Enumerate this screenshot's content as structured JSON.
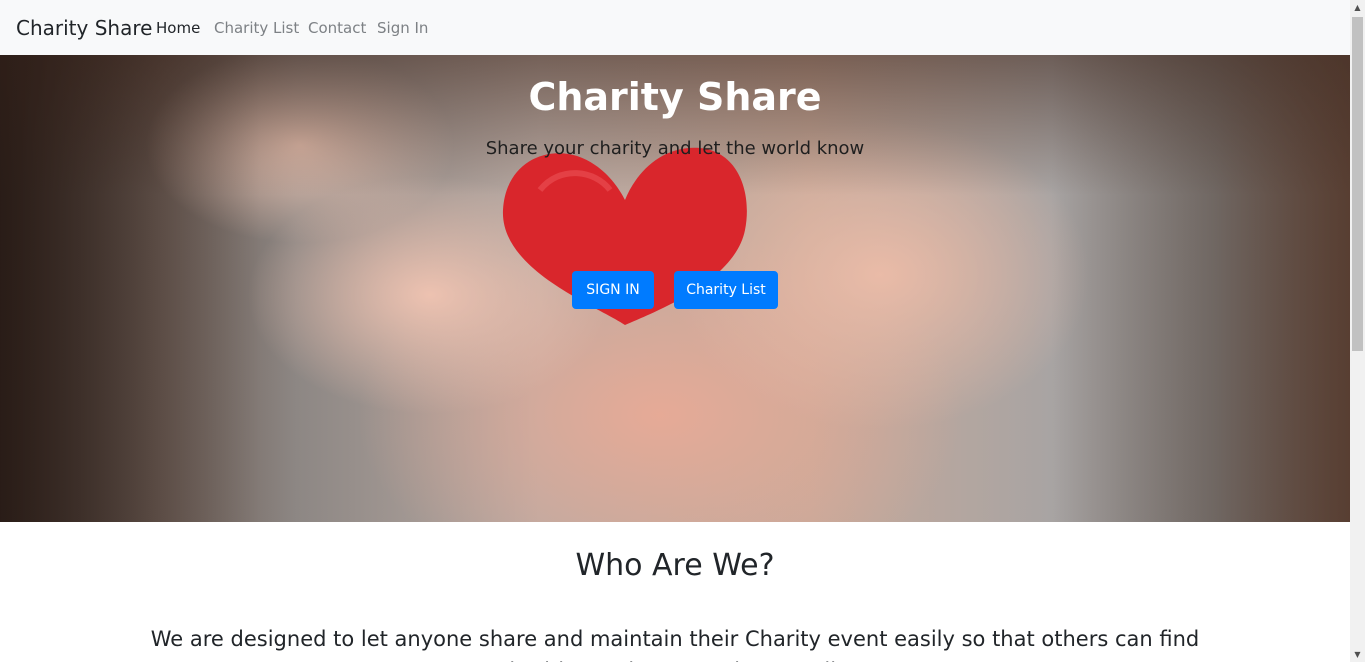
{
  "navbar": {
    "brand": "Charity Share",
    "links": [
      {
        "label": "Home",
        "active": true
      },
      {
        "label": "Charity List",
        "active": false
      },
      {
        "label": "Contact",
        "active": false
      },
      {
        "label": "Sign In",
        "active": false
      }
    ]
  },
  "hero": {
    "title": "Charity Share",
    "subtitle": "Share your charity and let the world know",
    "buttons": {
      "sign_in": "SIGN IN",
      "charity_list": "Charity List"
    },
    "image_icon": "heart-in-hands-icon"
  },
  "about": {
    "title": "Who Are We?",
    "text": "We are designed to let anyone share and maintain their Charity event easily so that others can find charities and contact them easily."
  },
  "colors": {
    "navbar_bg": "#f8f9fa",
    "primary": "#007bff",
    "heart": "#d9262c",
    "text_dark": "#212529",
    "nav_muted": "#7d8185"
  }
}
